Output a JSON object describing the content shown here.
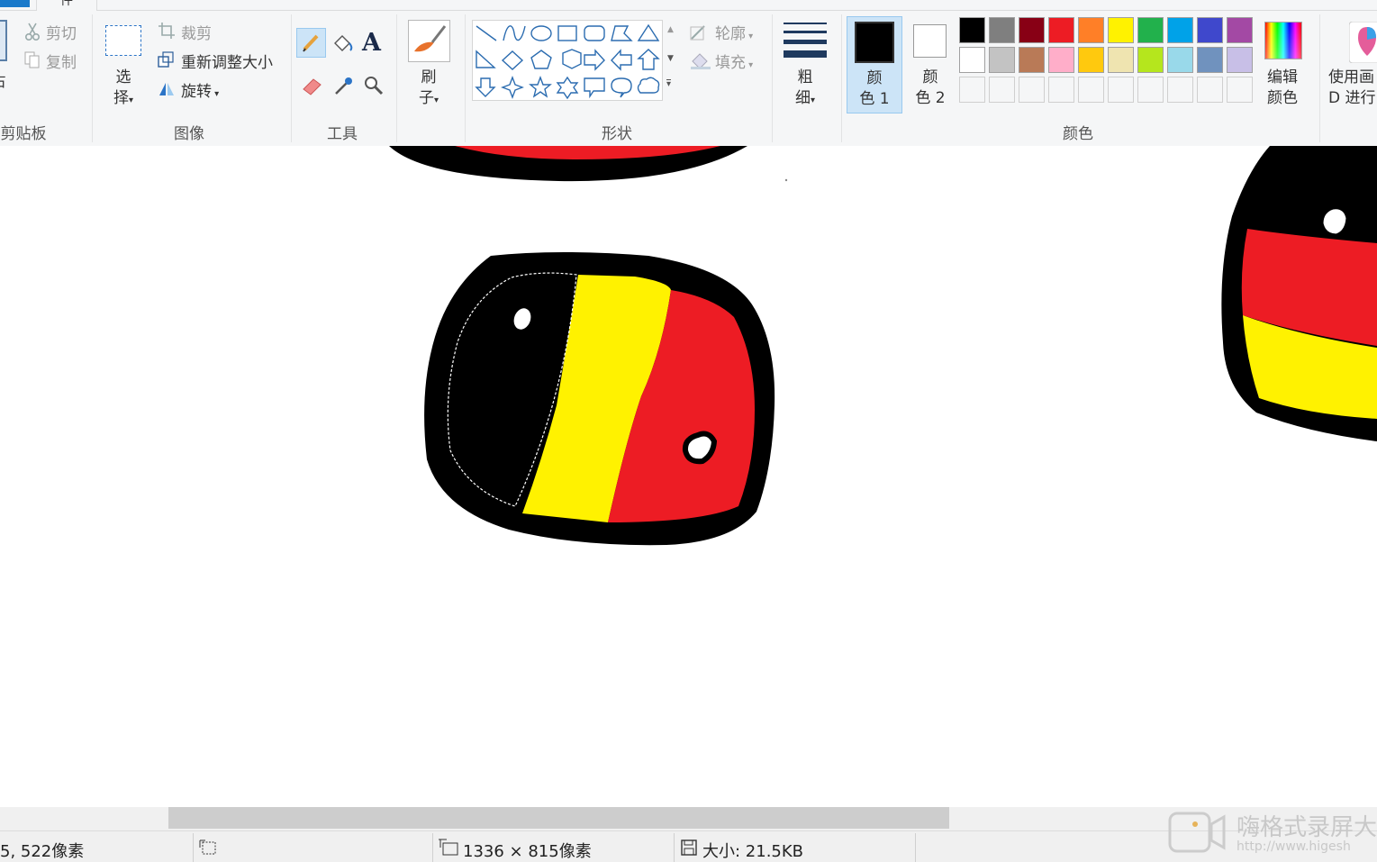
{
  "ribbon": {
    "tabs": {
      "home_partial": "件"
    },
    "clipboard": {
      "paste_partial": "占",
      "cut": "剪切",
      "copy": "复制",
      "group_label": "剪贴板"
    },
    "select": {
      "label_line1": "选",
      "label_line2": "择"
    },
    "image": {
      "crop": "裁剪",
      "resize": "重新调整大小",
      "rotate": "旋转",
      "group_label": "图像"
    },
    "tools": {
      "group_label": "工具",
      "text_tool": "A"
    },
    "brushes": {
      "label_line1": "刷",
      "label_line2": "子"
    },
    "shapes": {
      "outline": "轮廓",
      "fill": "填充",
      "group_label": "形状"
    },
    "size": {
      "label_line1": "粗",
      "label_line2": "细"
    },
    "colors": {
      "color1_line1": "颜",
      "color1_line2": "色 1",
      "color2_line1": "颜",
      "color2_line2": "色 2",
      "edit_line1": "编辑",
      "edit_line2": "颜色",
      "group_label": "颜色",
      "palette_row1": [
        "#000000",
        "#7f7f7f",
        "#880015",
        "#ed1c24",
        "#ff7f27",
        "#fff200",
        "#22b14c",
        "#00a2e8",
        "#3f48cc",
        "#a349a4"
      ],
      "palette_row2": [
        "#ffffff",
        "#c3c3c3",
        "#b97a57",
        "#ffaec9",
        "#ffc90e",
        "#efe4b0",
        "#b5e61d",
        "#99d9ea",
        "#7092be",
        "#c8bfe7"
      ],
      "palette_row3": [
        "#f5f6f7",
        "#f5f6f7",
        "#f5f6f7",
        "#f5f6f7",
        "#f5f6f7",
        "#f5f6f7",
        "#f5f6f7",
        "#f5f6f7",
        "#f5f6f7",
        "#f5f6f7"
      ],
      "color1": "#000000",
      "color2": "#ffffff"
    },
    "paint3d": {
      "label_line1": "使用画",
      "label_line2": "D 进行"
    }
  },
  "status": {
    "cursor_pos": "5, 522像素",
    "image_size": "1336 × 815像素",
    "file_size": "大小: 21.5KB"
  },
  "watermark": {
    "line1": "嗨格式录屏大",
    "line2": "http://www.higesh"
  }
}
